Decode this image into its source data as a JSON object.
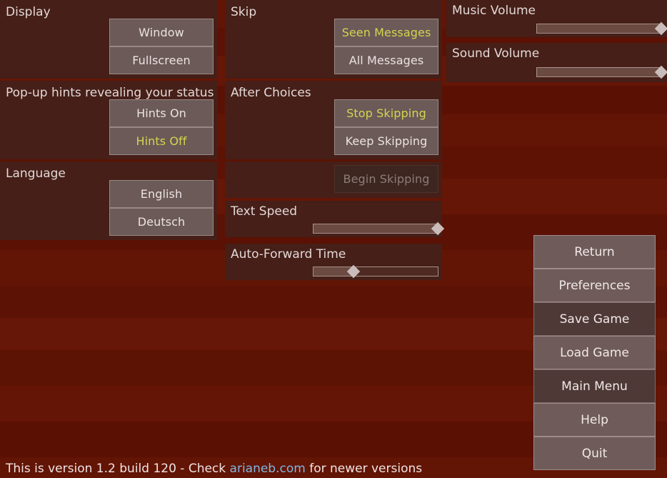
{
  "window": {
    "title": "Preferences",
    "background_color": "#5e1204",
    "panel_color": "#451f18",
    "button_color": "#6b5a58",
    "selected_text_color": "#d4d44e",
    "text_color": "#ece3e2",
    "link_color": "#7fb6e0"
  },
  "left_column": {
    "display": {
      "title": "Display",
      "options": [
        {
          "label": "Window",
          "selected": false
        },
        {
          "label": "Fullscreen",
          "selected": false
        }
      ]
    },
    "hints": {
      "title": "Pop-up hints revealing your status",
      "options": [
        {
          "label": "Hints On",
          "selected": false
        },
        {
          "label": "Hints Off",
          "selected": true
        }
      ]
    },
    "language": {
      "title": "Language",
      "options": [
        {
          "label": "English",
          "selected": false
        },
        {
          "label": "Deutsch",
          "selected": false
        }
      ]
    }
  },
  "middle_column": {
    "skip": {
      "title": "Skip",
      "options": [
        {
          "label": "Seen Messages",
          "selected": true
        },
        {
          "label": "All Messages",
          "selected": false
        }
      ]
    },
    "after_choices": {
      "title": "After Choices",
      "options": [
        {
          "label": "Stop Skipping",
          "selected": true
        },
        {
          "label": "Keep Skipping",
          "selected": false
        }
      ]
    },
    "begin_skipping": {
      "label": "Begin Skipping",
      "disabled": true
    },
    "text_speed": {
      "title": "Text Speed",
      "value": 100,
      "min": 0,
      "max": 100
    },
    "auto_forward_time": {
      "title": "Auto-Forward Time",
      "value": 32,
      "min": 0,
      "max": 100
    }
  },
  "right_column": {
    "music_volume": {
      "title": "Music Volume",
      "value": 100,
      "min": 0,
      "max": 100
    },
    "sound_volume": {
      "title": "Sound Volume",
      "value": 100,
      "min": 0,
      "max": 100
    }
  },
  "nav_menu": {
    "items": [
      {
        "label": "Return",
        "dim": false
      },
      {
        "label": "Preferences",
        "dim": false
      },
      {
        "label": "Save Game",
        "dim": true
      },
      {
        "label": "Load Game",
        "dim": false
      },
      {
        "label": "Main Menu",
        "dim": true
      },
      {
        "label": "Help",
        "dim": false
      },
      {
        "label": "Quit",
        "dim": false
      }
    ]
  },
  "footer": {
    "prefix": "This is version 1.2 build 120  -  Check ",
    "link": "arianeb.com",
    "suffix": " for newer versions"
  }
}
